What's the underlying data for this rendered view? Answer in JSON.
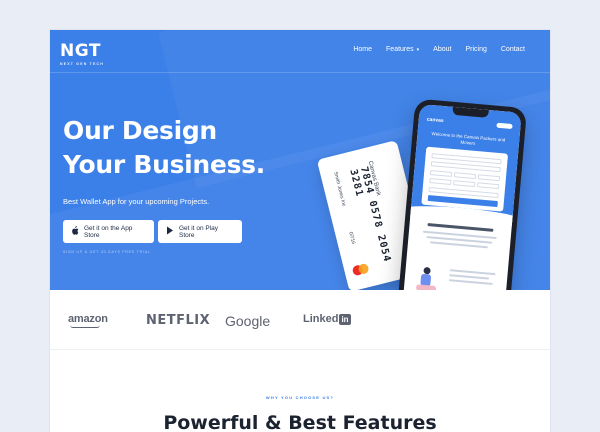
{
  "brand": {
    "logo": "NGT",
    "tagline": "NEXT GEN TECH"
  },
  "nav": {
    "items": [
      {
        "label": "Home"
      },
      {
        "label": "Features",
        "has_dropdown": true
      },
      {
        "label": "About"
      },
      {
        "label": "Pricing"
      },
      {
        "label": "Contact"
      }
    ]
  },
  "hero": {
    "headline_line1": "Our Design",
    "headline_line2": "Your Business.",
    "subtext": "Best Wallet App for your upcoming Projects.",
    "app_store_label": "Get it on the App Store",
    "play_store_label": "Get it on Play Store",
    "signup_note": "SIGN UP & GET 30 DAYS FREE TRIAL"
  },
  "card": {
    "bank": "Canvas Bank",
    "number": "7854 0578 2054 3281",
    "holder": "Smith Jones Inc",
    "expiry": "07/16"
  },
  "phone": {
    "brand": "canvas",
    "title": "Welcome to the Canvas Packers and Movers"
  },
  "partners": {
    "amazon": "amazon",
    "netflix": "NETFLIX",
    "google": "Google",
    "linkedin_text": "Linked",
    "linkedin_badge": "in"
  },
  "features": {
    "eyebrow": "WHY YOU CHOOSE US?",
    "title": "Powerful & Best Features"
  },
  "colors": {
    "primary": "#3b7fe8",
    "text_dark": "#1b2230",
    "partner_gray": "#5d6370"
  }
}
